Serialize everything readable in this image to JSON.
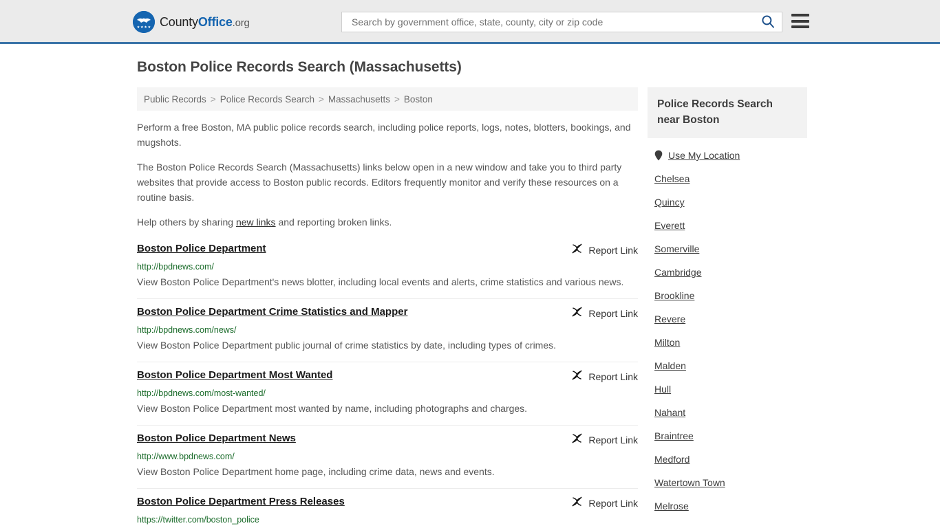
{
  "header": {
    "logo": {
      "icon": "eagle-badge-icon",
      "text_part1": "County",
      "text_part2": "Office",
      "text_part3": ".org"
    },
    "search": {
      "placeholder": "Search by government office, state, county, city or zip code",
      "value": "",
      "search_icon": "search-icon"
    },
    "menu_icon": "hamburger-menu-icon",
    "accent_color": "#3b74a8",
    "background_color": "#ebebeb"
  },
  "page_title": "Boston Police Records Search (Massachusetts)",
  "breadcrumb": {
    "items": [
      "Public Records",
      "Police Records Search",
      "Massachusetts",
      "Boston"
    ],
    "separator": ">"
  },
  "intro": {
    "paragraph1": "Perform a free Boston, MA public police records search, including police reports, logs, notes, blotters, bookings, and mugshots.",
    "paragraph2": "The Boston Police Records Search (Massachusetts) links below open in a new window and take you to third party websites that provide access to Boston public records. Editors frequently monitor and verify these resources on a routine basis.",
    "paragraph3_before": "Help others by sharing ",
    "paragraph3_link": "new links",
    "paragraph3_after": " and reporting broken links."
  },
  "results": {
    "report_label": "Report Link",
    "report_icon": "broken-link-icon",
    "url_color": "#1a6b2a",
    "items": [
      {
        "title": "Boston Police Department",
        "url": "http://bpdnews.com/",
        "description": "View Boston Police Department's news blotter, including local events and alerts, crime statistics and various news."
      },
      {
        "title": "Boston Police Department Crime Statistics and Mapper",
        "url": "http://bpdnews.com/news/",
        "description": "View Boston Police Department public journal of crime statistics by date, including types of crimes."
      },
      {
        "title": "Boston Police Department Most Wanted",
        "url": "http://bpdnews.com/most-wanted/",
        "description": "View Boston Police Department most wanted by name, including photographs and charges."
      },
      {
        "title": "Boston Police Department News",
        "url": "http://www.bpdnews.com/",
        "description": "View Boston Police Department home page, including crime data, news and events."
      },
      {
        "title": "Boston Police Department Press Releases",
        "url": "https://twitter.com/boston_police",
        "description": ""
      }
    ]
  },
  "sidebar": {
    "heading": "Police Records Search near Boston",
    "use_my_location": {
      "label": "Use My Location",
      "icon": "map-pin-icon"
    },
    "cities": [
      "Chelsea",
      "Quincy",
      "Everett",
      "Somerville",
      "Cambridge",
      "Brookline",
      "Revere",
      "Milton",
      "Malden",
      "Hull",
      "Nahant",
      "Braintree",
      "Medford",
      "Watertown Town",
      "Melrose"
    ]
  }
}
